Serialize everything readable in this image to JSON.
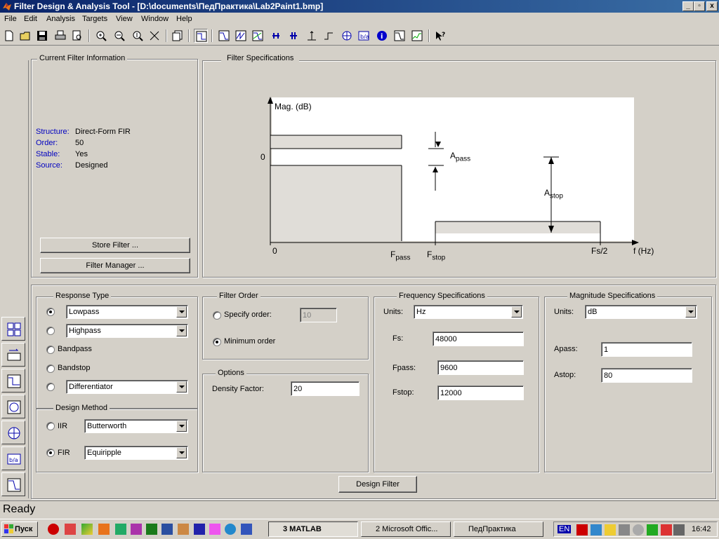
{
  "window": {
    "title": "Filter Design & Analysis Tool - [D:\\documents\\ПедПрактика\\Lab2Paint1.bmp]"
  },
  "menu": [
    "File",
    "Edit",
    "Analysis",
    "Targets",
    "View",
    "Window",
    "Help"
  ],
  "current_filter": {
    "title": "Current Filter Information",
    "rows": [
      {
        "label": "Structure:",
        "value": "Direct-Form FIR"
      },
      {
        "label": "Order:",
        "value": "50"
      },
      {
        "label": "Stable:",
        "value": "Yes"
      },
      {
        "label": "Source:",
        "value": "Designed"
      }
    ],
    "store_button": "Store Filter ...",
    "manager_button": "Filter Manager ..."
  },
  "spec_plot": {
    "title": "Filter Specifications",
    "ylabel": "Mag. (dB)",
    "y_zero": "0",
    "x_zero": "0",
    "fpass": {
      "main": "F",
      "sub": "pass"
    },
    "fstop": {
      "main": "F",
      "sub": "stop"
    },
    "fs2": "Fs/2",
    "xlabel": "f (Hz)",
    "apass": {
      "main": "A",
      "sub": "pass"
    },
    "astop": {
      "main": "A",
      "sub": "stop"
    }
  },
  "response_type": {
    "title": "Response Type",
    "lowpass": "Lowpass",
    "highpass": "Highpass",
    "bandpass": "Bandpass",
    "bandstop": "Bandstop",
    "differentiator": "Differentiator",
    "selected": "Lowpass"
  },
  "design_method": {
    "title": "Design Method",
    "iir_label": "IIR",
    "iir_value": "Butterworth",
    "fir_label": "FIR",
    "fir_value": "Equiripple",
    "selected": "FIR"
  },
  "filter_order": {
    "title": "Filter Order",
    "specify_label": "Specify order:",
    "specify_value": "10",
    "minimum_label": "Minimum order",
    "selected": "Minimum order"
  },
  "options": {
    "title": "Options",
    "density_label": "Density Factor:",
    "density_value": "20"
  },
  "freq_spec": {
    "title": "Frequency Specifications",
    "units_label": "Units:",
    "units_value": "Hz",
    "fs_label": "Fs:",
    "fs_value": "48000",
    "fpass_label": "Fpass:",
    "fpass_value": "9600",
    "fstop_label": "Fstop:",
    "fstop_value": "12000"
  },
  "mag_spec": {
    "title": "Magnitude Specifications",
    "units_label": "Units:",
    "units_value": "dB",
    "apass_label": "Apass:",
    "apass_value": "1",
    "astop_label": "Astop:",
    "astop_value": "80"
  },
  "design_button": "Design Filter",
  "status": "Ready",
  "taskbar": {
    "start": "Пуск",
    "tasks": [
      "3 MATLAB",
      "2 Microsoft Offic...",
      "ПедПрактика"
    ],
    "lang": "EN",
    "clock": "16:42"
  },
  "colors": {
    "titlebar": "#0a246a",
    "face": "#d4d0c8",
    "label_blue": "#0000c0"
  }
}
